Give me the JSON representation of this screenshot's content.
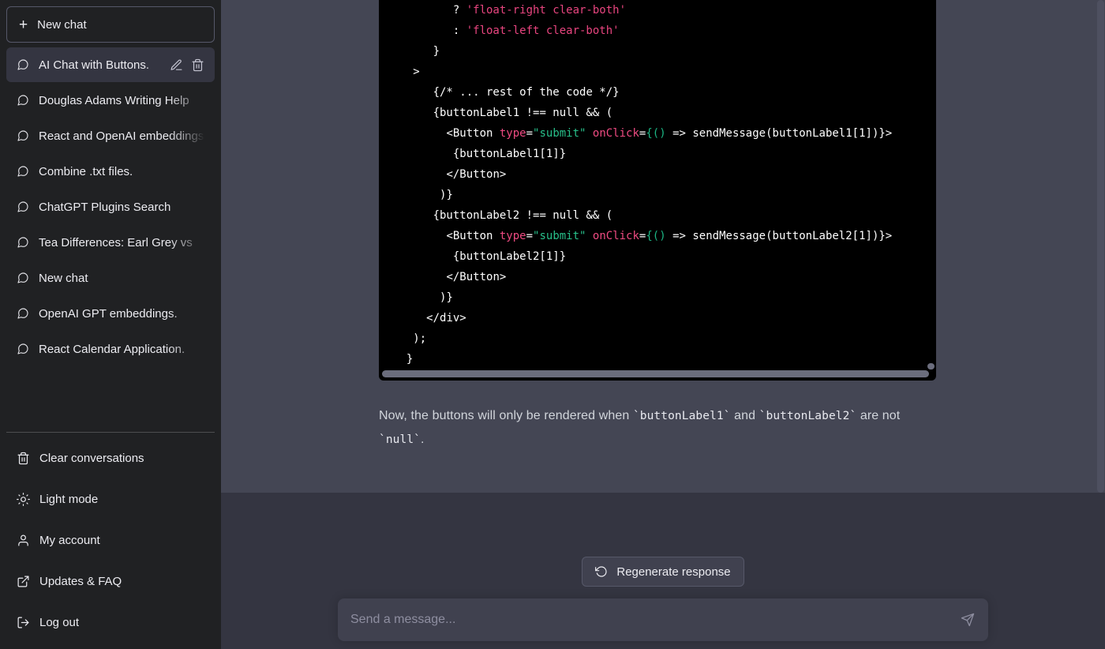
{
  "sidebar": {
    "new_chat_label": "New chat",
    "conversations": [
      {
        "label": "AI Chat with Buttons.",
        "active": true
      },
      {
        "label": "Douglas Adams Writing Help",
        "active": false
      },
      {
        "label": "React and OpenAI embeddings",
        "active": false
      },
      {
        "label": "Combine .txt files.",
        "active": false
      },
      {
        "label": "ChatGPT Plugins Search",
        "active": false
      },
      {
        "label": "Tea Differences: Earl Grey vs",
        "active": false
      },
      {
        "label": "New chat",
        "active": false
      },
      {
        "label": "OpenAI GPT embeddings.",
        "active": false
      },
      {
        "label": "React Calendar Application.",
        "active": false
      }
    ],
    "footer": [
      {
        "label": "Clear conversations",
        "icon": "trash-icon"
      },
      {
        "label": "Light mode",
        "icon": "sun-icon"
      },
      {
        "label": "My account",
        "icon": "user-icon"
      },
      {
        "label": "Updates & FAQ",
        "icon": "external-link-icon"
      },
      {
        "label": "Log out",
        "icon": "logout-icon"
      }
    ]
  },
  "message": {
    "code": [
      {
        "indent": 9,
        "parts": [
          {
            "t": "? ",
            "c": "plain"
          },
          {
            "t": "'float-right clear-both'",
            "c": "str"
          }
        ]
      },
      {
        "indent": 9,
        "parts": [
          {
            "t": ": ",
            "c": "plain"
          },
          {
            "t": "'float-left clear-both'",
            "c": "str"
          }
        ]
      },
      {
        "indent": 6,
        "parts": [
          {
            "t": "}",
            "c": "plain"
          }
        ]
      },
      {
        "indent": 3,
        "parts": [
          {
            "t": ">",
            "c": "plain"
          }
        ]
      },
      {
        "indent": 6,
        "parts": [
          {
            "t": "{/* ... rest of the code */}",
            "c": "plain"
          }
        ]
      },
      {
        "indent": 6,
        "parts": [
          {
            "t": "{buttonLabel1 !== null && (",
            "c": "plain"
          }
        ]
      },
      {
        "indent": 8,
        "parts": [
          {
            "t": "<Button ",
            "c": "plain"
          },
          {
            "t": "type",
            "c": "attr"
          },
          {
            "t": "=",
            "c": "plain"
          },
          {
            "t": "\"submit\"",
            "c": "val"
          },
          {
            "t": " ",
            "c": "plain"
          },
          {
            "t": "onClick",
            "c": "attr"
          },
          {
            "t": "=",
            "c": "plain"
          },
          {
            "t": "{()",
            "c": "paren"
          },
          {
            "t": " => sendMessage(buttonLabel1[1])}>",
            "c": "plain"
          }
        ]
      },
      {
        "indent": 9,
        "parts": [
          {
            "t": "{buttonLabel1[1]}",
            "c": "plain"
          }
        ]
      },
      {
        "indent": 8,
        "parts": [
          {
            "t": "</Button>",
            "c": "plain"
          }
        ]
      },
      {
        "indent": 7,
        "parts": [
          {
            "t": ")}",
            "c": "plain"
          }
        ]
      },
      {
        "indent": 6,
        "parts": [
          {
            "t": "{buttonLabel2 !== null && (",
            "c": "plain"
          }
        ]
      },
      {
        "indent": 8,
        "parts": [
          {
            "t": "<Button ",
            "c": "plain"
          },
          {
            "t": "type",
            "c": "attr"
          },
          {
            "t": "=",
            "c": "plain"
          },
          {
            "t": "\"submit\"",
            "c": "val"
          },
          {
            "t": " ",
            "c": "plain"
          },
          {
            "t": "onClick",
            "c": "attr"
          },
          {
            "t": "=",
            "c": "plain"
          },
          {
            "t": "{()",
            "c": "paren"
          },
          {
            "t": " => sendMessage(buttonLabel2[1])}>",
            "c": "plain"
          }
        ]
      },
      {
        "indent": 9,
        "parts": [
          {
            "t": "{buttonLabel2[1]}",
            "c": "plain"
          }
        ]
      },
      {
        "indent": 8,
        "parts": [
          {
            "t": "</Button>",
            "c": "plain"
          }
        ]
      },
      {
        "indent": 7,
        "parts": [
          {
            "t": ")}",
            "c": "plain"
          }
        ]
      },
      {
        "indent": 5,
        "parts": [
          {
            "t": "</div>",
            "c": "plain"
          }
        ]
      },
      {
        "indent": 3,
        "parts": [
          {
            "t": ");",
            "c": "plain"
          }
        ]
      },
      {
        "indent": 2,
        "parts": [
          {
            "t": "}",
            "c": "plain"
          }
        ]
      }
    ],
    "paragraph": {
      "before": "Now, the buttons will only be rendered when ",
      "code1": "`buttonLabel1`",
      "middle": " and ",
      "code2": "`buttonLabel2`",
      "after": " are not ",
      "code3": "`null`",
      "end": "."
    }
  },
  "composer": {
    "regenerate_label": "Regenerate response",
    "input_placeholder": "Send a message...",
    "input_value": ""
  },
  "colors": {
    "sidebar_bg": "#202123",
    "assistant_msg_bg": "#444654",
    "composer_bg": "#343541",
    "code_bg": "#000000",
    "accent_pink": "#e8457f",
    "accent_green": "#28c08a",
    "text_primary": "#ececf1"
  }
}
